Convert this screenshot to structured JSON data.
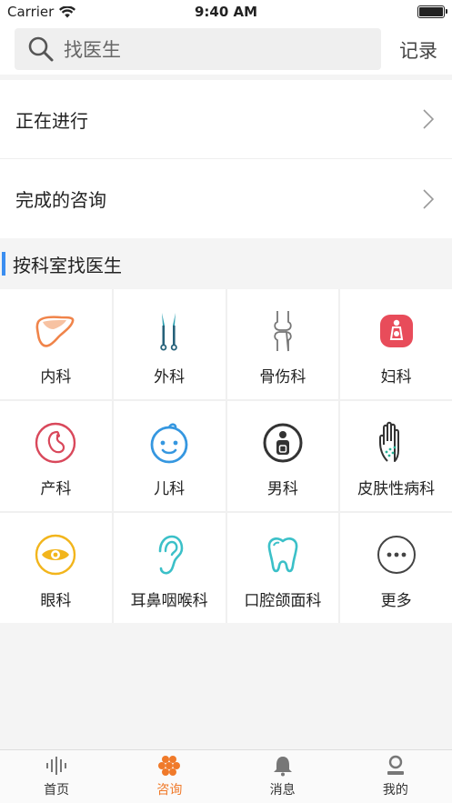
{
  "status_bar": {
    "carrier": "Carrier",
    "time": "9:40 AM"
  },
  "search": {
    "placeholder": "找医生",
    "record_label": "记录"
  },
  "consult_list": [
    {
      "label": "正在进行"
    },
    {
      "label": "完成的咨询"
    }
  ],
  "section": {
    "title": "按科室找医生"
  },
  "departments": [
    {
      "label": "内科",
      "icon": "liver-icon"
    },
    {
      "label": "外科",
      "icon": "scalpel-icon"
    },
    {
      "label": "骨伤科",
      "icon": "bone-icon"
    },
    {
      "label": "妇科",
      "icon": "pregnant-woman-icon"
    },
    {
      "label": "产科",
      "icon": "fetus-icon"
    },
    {
      "label": "儿科",
      "icon": "baby-face-icon"
    },
    {
      "label": "男科",
      "icon": "man-icon"
    },
    {
      "label": "皮肤性病科",
      "icon": "hand-icon"
    },
    {
      "label": "眼科",
      "icon": "eye-icon"
    },
    {
      "label": "耳鼻咽喉科",
      "icon": "ear-icon"
    },
    {
      "label": "口腔颌面科",
      "icon": "tooth-icon"
    },
    {
      "label": "更多",
      "icon": "more-icon"
    }
  ],
  "tabbar": {
    "tabs": [
      {
        "label": "首页",
        "icon": "soundwave-icon"
      },
      {
        "label": "咨询",
        "icon": "honeycomb-icon",
        "active": true
      },
      {
        "label": "消息",
        "icon": "bell-icon"
      },
      {
        "label": "我的",
        "icon": "person-icon"
      }
    ],
    "active_color": "#f07a2a"
  }
}
